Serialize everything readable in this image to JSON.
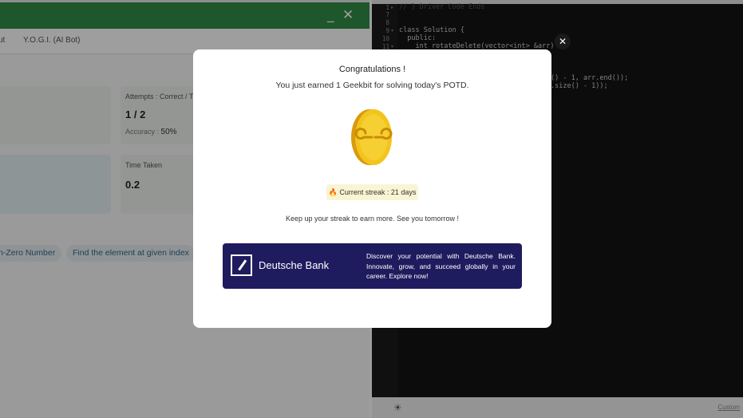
{
  "left_panel": {
    "window_controls": {
      "minimize": "_",
      "close": "✕"
    },
    "tabs": [
      "ut",
      "Y.O.G.I. (AI Bot)"
    ],
    "cards": {
      "attempts_label": "Attempts : Correct / T",
      "attempts_value": "1 / 2",
      "accuracy_label": "Accuracy :",
      "accuracy_value": "50%",
      "time_label": "Time Taken",
      "time_value": "0.2"
    },
    "chips": [
      "n-Zero Number",
      "Find the element at given index"
    ]
  },
  "editor": {
    "lines": [
      {
        "num": "1",
        "text": "// } Driver Code Ends",
        "dim": true
      },
      {
        "num": "7",
        "text": ""
      },
      {
        "num": "8",
        "text": ""
      },
      {
        "num": "9",
        "text": "class Solution {"
      },
      {
        "num": "10",
        "text": "  public:"
      },
      {
        "num": "11",
        "text": "    int rotateDelete(vector<int> &arr) {"
      }
    ],
    "hidden_fragment_1": "() - 1, arr.end());",
    "hidden_fragment_2": ".size() - 1));",
    "bottom_link": "Custom"
  },
  "modal": {
    "close": "✕",
    "title": "Congratulations !",
    "subtitle": "You just earned 1 Geekbit for solving today's POTD.",
    "streak_icon": "flame-icon",
    "streak_text": "Current streak : 21 days",
    "keep_text": "Keep up your streak to earn more. See you tomorrow !",
    "ad": {
      "brand": "Deutsche Bank",
      "description": "Discover your potential with Deutsche Bank. Innovate, grow, and succeed globally in your career. Explore now!"
    }
  },
  "colors": {
    "brand_green": "#2f8d46",
    "coin_gold": "#f3c41c",
    "ad_navy": "#1e1c5e",
    "editor_bg": "#141414"
  }
}
